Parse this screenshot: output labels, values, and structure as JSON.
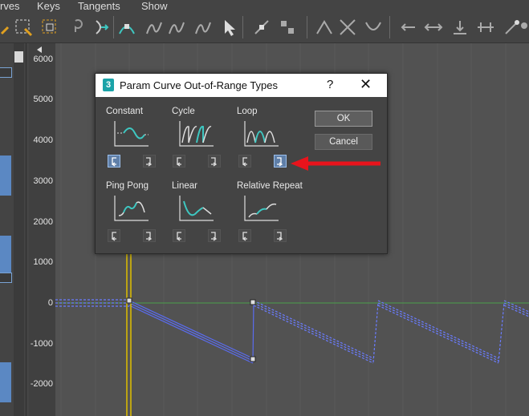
{
  "menu": [
    "rves",
    "Keys",
    "Tangents",
    "Show"
  ],
  "y_axis_labels": [
    "6000",
    "5000",
    "4000",
    "3000",
    "2000",
    "1000",
    "0",
    "-1000",
    "-2000"
  ],
  "dialog": {
    "title": "Param Curve Out-of-Range Types",
    "help": "?",
    "close": "✕",
    "logo": "3",
    "ok": "OK",
    "cancel": "Cancel",
    "types": [
      "Constant",
      "Cycle",
      "Loop",
      "Ping Pong",
      "Linear",
      "Relative Repeat"
    ]
  },
  "colors": {
    "accent": "#3ec7c1",
    "selected_button": "#5f7fa8",
    "curve": "#5a6cf0",
    "annotation_arrow": "#e8141c",
    "playhead": "#e0c000"
  }
}
